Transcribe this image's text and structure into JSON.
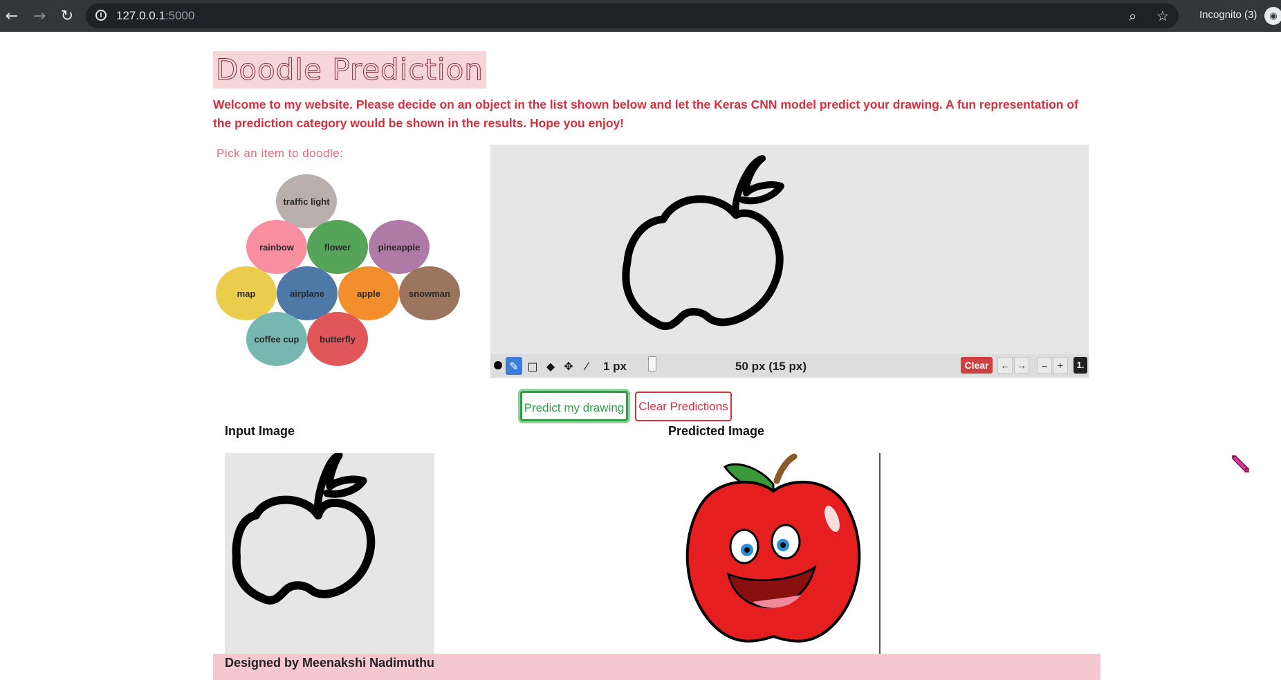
{
  "browser": {
    "url_host": "127.0.0.1",
    "url_port": ":5000",
    "incognito_label": "Incognito (3)"
  },
  "page": {
    "title": "Doodle Prediction",
    "welcome": "Welcome to my website. Please decide on an object in the list shown below and let the Keras CNN model predict your drawing. A fun representation of the prediction category would be shown in the results. Hope you enjoy!",
    "pick_label": "Pick an item to doodle:",
    "items": [
      {
        "label": "traffic light",
        "color": "#b9b0ad"
      },
      {
        "label": "rainbow",
        "color": "#f78fa0"
      },
      {
        "label": "flower",
        "color": "#56a35a"
      },
      {
        "label": "pineapple",
        "color": "#b07aa6"
      },
      {
        "label": "map",
        "color": "#ebcd4d"
      },
      {
        "label": "airplane",
        "color": "#4e79a7"
      },
      {
        "label": "apple",
        "color": "#f28e2b"
      },
      {
        "label": "snowman",
        "color": "#9c755f"
      },
      {
        "label": "coffee cup",
        "color": "#76b7b2"
      },
      {
        "label": "butterfly",
        "color": "#e15759"
      }
    ]
  },
  "toolbar": {
    "brush_size_label": "1 px",
    "size_readout": "50 px (15 px)",
    "clear_label": "Clear",
    "undo_label": "←",
    "redo_label": "→",
    "zoom_out_label": "–",
    "zoom_in_label": "+",
    "zoom_value": "1."
  },
  "buttons": {
    "predict": "Predict my drawing",
    "clear_predictions": "Clear Predictions"
  },
  "results": {
    "input_label": "Input Image",
    "predicted_label": "Predicted Image"
  },
  "footer": {
    "text": "Designed by Meenakshi Nadimuthu"
  },
  "colors": {
    "accent_red": "#d6303f",
    "title_bg": "#f7d6da",
    "footer_bg": "#f5c8cf",
    "predict_green": "#2f9e44"
  }
}
